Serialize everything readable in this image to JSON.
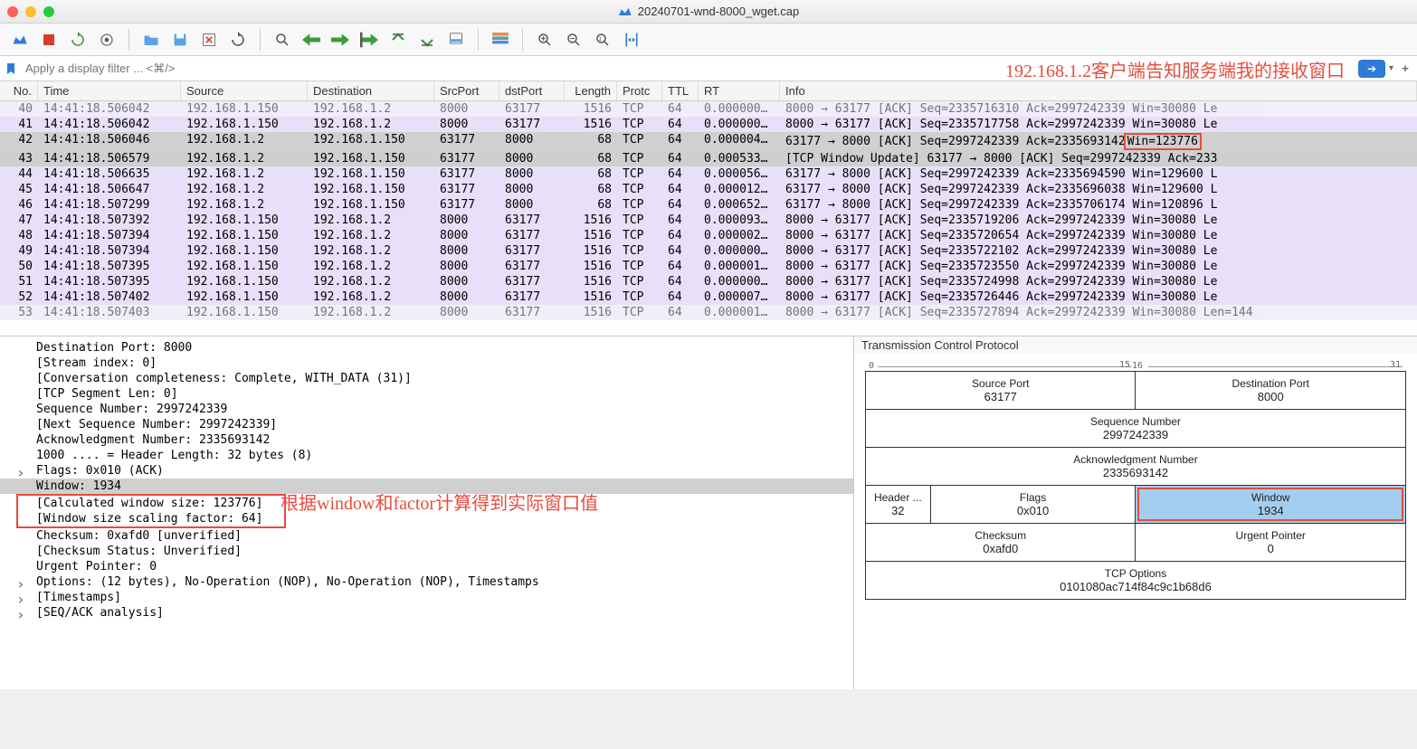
{
  "window": {
    "title": "20240701-wnd-8000_wget.cap"
  },
  "filter": {
    "placeholder": "Apply a display filter ... <⌘/>"
  },
  "annotations": {
    "top": "192.168.1.2客户端告知服务端我的接收窗口",
    "mid": "根据window和factor计算得到实际窗口值"
  },
  "columns": {
    "no": "No.",
    "time": "Time",
    "source": "Source",
    "destination": "Destination",
    "srcport": "SrcPort",
    "dstport": "dstPort",
    "length": "Length",
    "proto": "Protc",
    "ttl": "TTL",
    "rt": "RT",
    "info": "Info"
  },
  "packets": [
    {
      "no": "40",
      "time": "14:41:18.506042",
      "src": "192.168.1.150",
      "dst": "192.168.1.2",
      "sport": "8000",
      "dport": "63177",
      "len": "1516",
      "proto": "TCP",
      "ttl": "64",
      "rt": "0.000000…",
      "info": "8000 → 63177 [ACK] Seq=2335716310 Ack=2997242339 Win=30080 Le",
      "cls": "purple",
      "partial": true
    },
    {
      "no": "41",
      "time": "14:41:18.506042",
      "src": "192.168.1.150",
      "dst": "192.168.1.2",
      "sport": "8000",
      "dport": "63177",
      "len": "1516",
      "proto": "TCP",
      "ttl": "64",
      "rt": "0.000000…",
      "info": "8000 → 63177 [ACK] Seq=2335717758 Ack=2997242339 Win=30080 Le",
      "cls": "purple"
    },
    {
      "no": "42",
      "time": "14:41:18.506046",
      "src": "192.168.1.2",
      "dst": "192.168.1.150",
      "sport": "63177",
      "dport": "8000",
      "len": "68",
      "proto": "TCP",
      "ttl": "64",
      "rt": "0.000004…",
      "info": "63177 → 8000 [ACK] Seq=2997242339 Ack=2335693142",
      "infoSuffix": " Win=123776",
      "cls": "selected",
      "redBox": true
    },
    {
      "no": "43",
      "time": "14:41:18.506579",
      "src": "192.168.1.2",
      "dst": "192.168.1.150",
      "sport": "63177",
      "dport": "8000",
      "len": "68",
      "proto": "TCP",
      "ttl": "64",
      "rt": "0.000533…",
      "info": "[TCP Window Update] 63177 → 8000 [ACK] Seq=2997242339 Ack=233",
      "cls": "gray"
    },
    {
      "no": "44",
      "time": "14:41:18.506635",
      "src": "192.168.1.2",
      "dst": "192.168.1.150",
      "sport": "63177",
      "dport": "8000",
      "len": "68",
      "proto": "TCP",
      "ttl": "64",
      "rt": "0.000056…",
      "info": "63177 → 8000 [ACK] Seq=2997242339 Ack=2335694590 Win=129600 L",
      "cls": "purple"
    },
    {
      "no": "45",
      "time": "14:41:18.506647",
      "src": "192.168.1.2",
      "dst": "192.168.1.150",
      "sport": "63177",
      "dport": "8000",
      "len": "68",
      "proto": "TCP",
      "ttl": "64",
      "rt": "0.000012…",
      "info": "63177 → 8000 [ACK] Seq=2997242339 Ack=2335696038 Win=129600 L",
      "cls": "purple"
    },
    {
      "no": "46",
      "time": "14:41:18.507299",
      "src": "192.168.1.2",
      "dst": "192.168.1.150",
      "sport": "63177",
      "dport": "8000",
      "len": "68",
      "proto": "TCP",
      "ttl": "64",
      "rt": "0.000652…",
      "info": "63177 → 8000 [ACK] Seq=2997242339 Ack=2335706174 Win=120896 L",
      "cls": "purple"
    },
    {
      "no": "47",
      "time": "14:41:18.507392",
      "src": "192.168.1.150",
      "dst": "192.168.1.2",
      "sport": "8000",
      "dport": "63177",
      "len": "1516",
      "proto": "TCP",
      "ttl": "64",
      "rt": "0.000093…",
      "info": "8000 → 63177 [ACK] Seq=2335719206 Ack=2997242339 Win=30080 Le",
      "cls": "purple"
    },
    {
      "no": "48",
      "time": "14:41:18.507394",
      "src": "192.168.1.150",
      "dst": "192.168.1.2",
      "sport": "8000",
      "dport": "63177",
      "len": "1516",
      "proto": "TCP",
      "ttl": "64",
      "rt": "0.000002…",
      "info": "8000 → 63177 [ACK] Seq=2335720654 Ack=2997242339 Win=30080 Le",
      "cls": "purple"
    },
    {
      "no": "49",
      "time": "14:41:18.507394",
      "src": "192.168.1.150",
      "dst": "192.168.1.2",
      "sport": "8000",
      "dport": "63177",
      "len": "1516",
      "proto": "TCP",
      "ttl": "64",
      "rt": "0.000000…",
      "info": "8000 → 63177 [ACK] Seq=2335722102 Ack=2997242339 Win=30080 Le",
      "cls": "purple"
    },
    {
      "no": "50",
      "time": "14:41:18.507395",
      "src": "192.168.1.150",
      "dst": "192.168.1.2",
      "sport": "8000",
      "dport": "63177",
      "len": "1516",
      "proto": "TCP",
      "ttl": "64",
      "rt": "0.000001…",
      "info": "8000 → 63177 [ACK] Seq=2335723550 Ack=2997242339 Win=30080 Le",
      "cls": "purple"
    },
    {
      "no": "51",
      "time": "14:41:18.507395",
      "src": "192.168.1.150",
      "dst": "192.168.1.2",
      "sport": "8000",
      "dport": "63177",
      "len": "1516",
      "proto": "TCP",
      "ttl": "64",
      "rt": "0.000000…",
      "info": "8000 → 63177 [ACK] Seq=2335724998 Ack=2997242339 Win=30080 Le",
      "cls": "purple"
    },
    {
      "no": "52",
      "time": "14:41:18.507402",
      "src": "192.168.1.150",
      "dst": "192.168.1.2",
      "sport": "8000",
      "dport": "63177",
      "len": "1516",
      "proto": "TCP",
      "ttl": "64",
      "rt": "0.000007…",
      "info": "8000 → 63177 [ACK] Seq=2335726446 Ack=2997242339 Win=30080 Le",
      "cls": "purple"
    },
    {
      "no": "53",
      "time": "14:41:18.507403",
      "src": "192.168.1.150",
      "dst": "192.168.1.2",
      "sport": "8000",
      "dport": "63177",
      "len": "1516",
      "proto": "TCP",
      "ttl": "64",
      "rt": "0.000001…",
      "info": "8000 → 63177 [ACK] Seq=2335727894 Ack=2997242339 Win=30080 Len=144",
      "cls": "purple",
      "partial": true
    }
  ],
  "details": [
    {
      "text": "Destination Port: 8000",
      "indent": 1
    },
    {
      "text": "[Stream index: 0]",
      "indent": 1
    },
    {
      "text": "[Conversation completeness: Complete, WITH_DATA (31)]",
      "indent": 1
    },
    {
      "text": "[TCP Segment Len: 0]",
      "indent": 1
    },
    {
      "text": "Sequence Number: 2997242339",
      "indent": 1
    },
    {
      "text": "[Next Sequence Number: 2997242339]",
      "indent": 1
    },
    {
      "text": "Acknowledgment Number: 2335693142",
      "indent": 1
    },
    {
      "text": "1000 .... = Header Length: 32 bytes (8)",
      "indent": 1
    },
    {
      "text": "Flags: 0x010 (ACK)",
      "indent": 1,
      "expandable": true
    },
    {
      "text": "Window: 1934",
      "indent": 1,
      "selected": true
    },
    {
      "text": "[Calculated window size: 123776]",
      "indent": 1,
      "redBox": "group-start"
    },
    {
      "text": "[Window size scaling factor: 64]",
      "indent": 1,
      "redBox": "group-end"
    },
    {
      "text": "Checksum: 0xafd0 [unverified]",
      "indent": 1
    },
    {
      "text": "[Checksum Status: Unverified]",
      "indent": 1
    },
    {
      "text": "Urgent Pointer: 0",
      "indent": 1
    },
    {
      "text": "Options: (12 bytes), No-Operation (NOP), No-Operation (NOP), Timestamps",
      "indent": 1,
      "expandable": true
    },
    {
      "text": "[Timestamps]",
      "indent": 1,
      "expandable": true
    },
    {
      "text": "[SEQ/ACK analysis]",
      "indent": 1,
      "expandable": true
    }
  ],
  "bytesTitle": "Transmission Control Protocol",
  "tcpHeader": {
    "ruler": {
      "left": "0",
      "midL": "15",
      "midR": "16",
      "right": "31"
    },
    "srcPort": {
      "label": "Source Port",
      "val": "63177"
    },
    "dstPort": {
      "label": "Destination Port",
      "val": "8000"
    },
    "seq": {
      "label": "Sequence Number",
      "val": "2997242339"
    },
    "ack": {
      "label": "Acknowledgment Number",
      "val": "2335693142"
    },
    "hdrLen": {
      "label": "Header ...",
      "val": "32"
    },
    "flags": {
      "label": "Flags",
      "val": "0x010"
    },
    "window": {
      "label": "Window",
      "val": "1934"
    },
    "checksum": {
      "label": "Checksum",
      "val": "0xafd0"
    },
    "urgent": {
      "label": "Urgent Pointer",
      "val": "0"
    },
    "options": {
      "label": "TCP Options",
      "val": "0101080ac714f84c9c1b68d6"
    }
  }
}
